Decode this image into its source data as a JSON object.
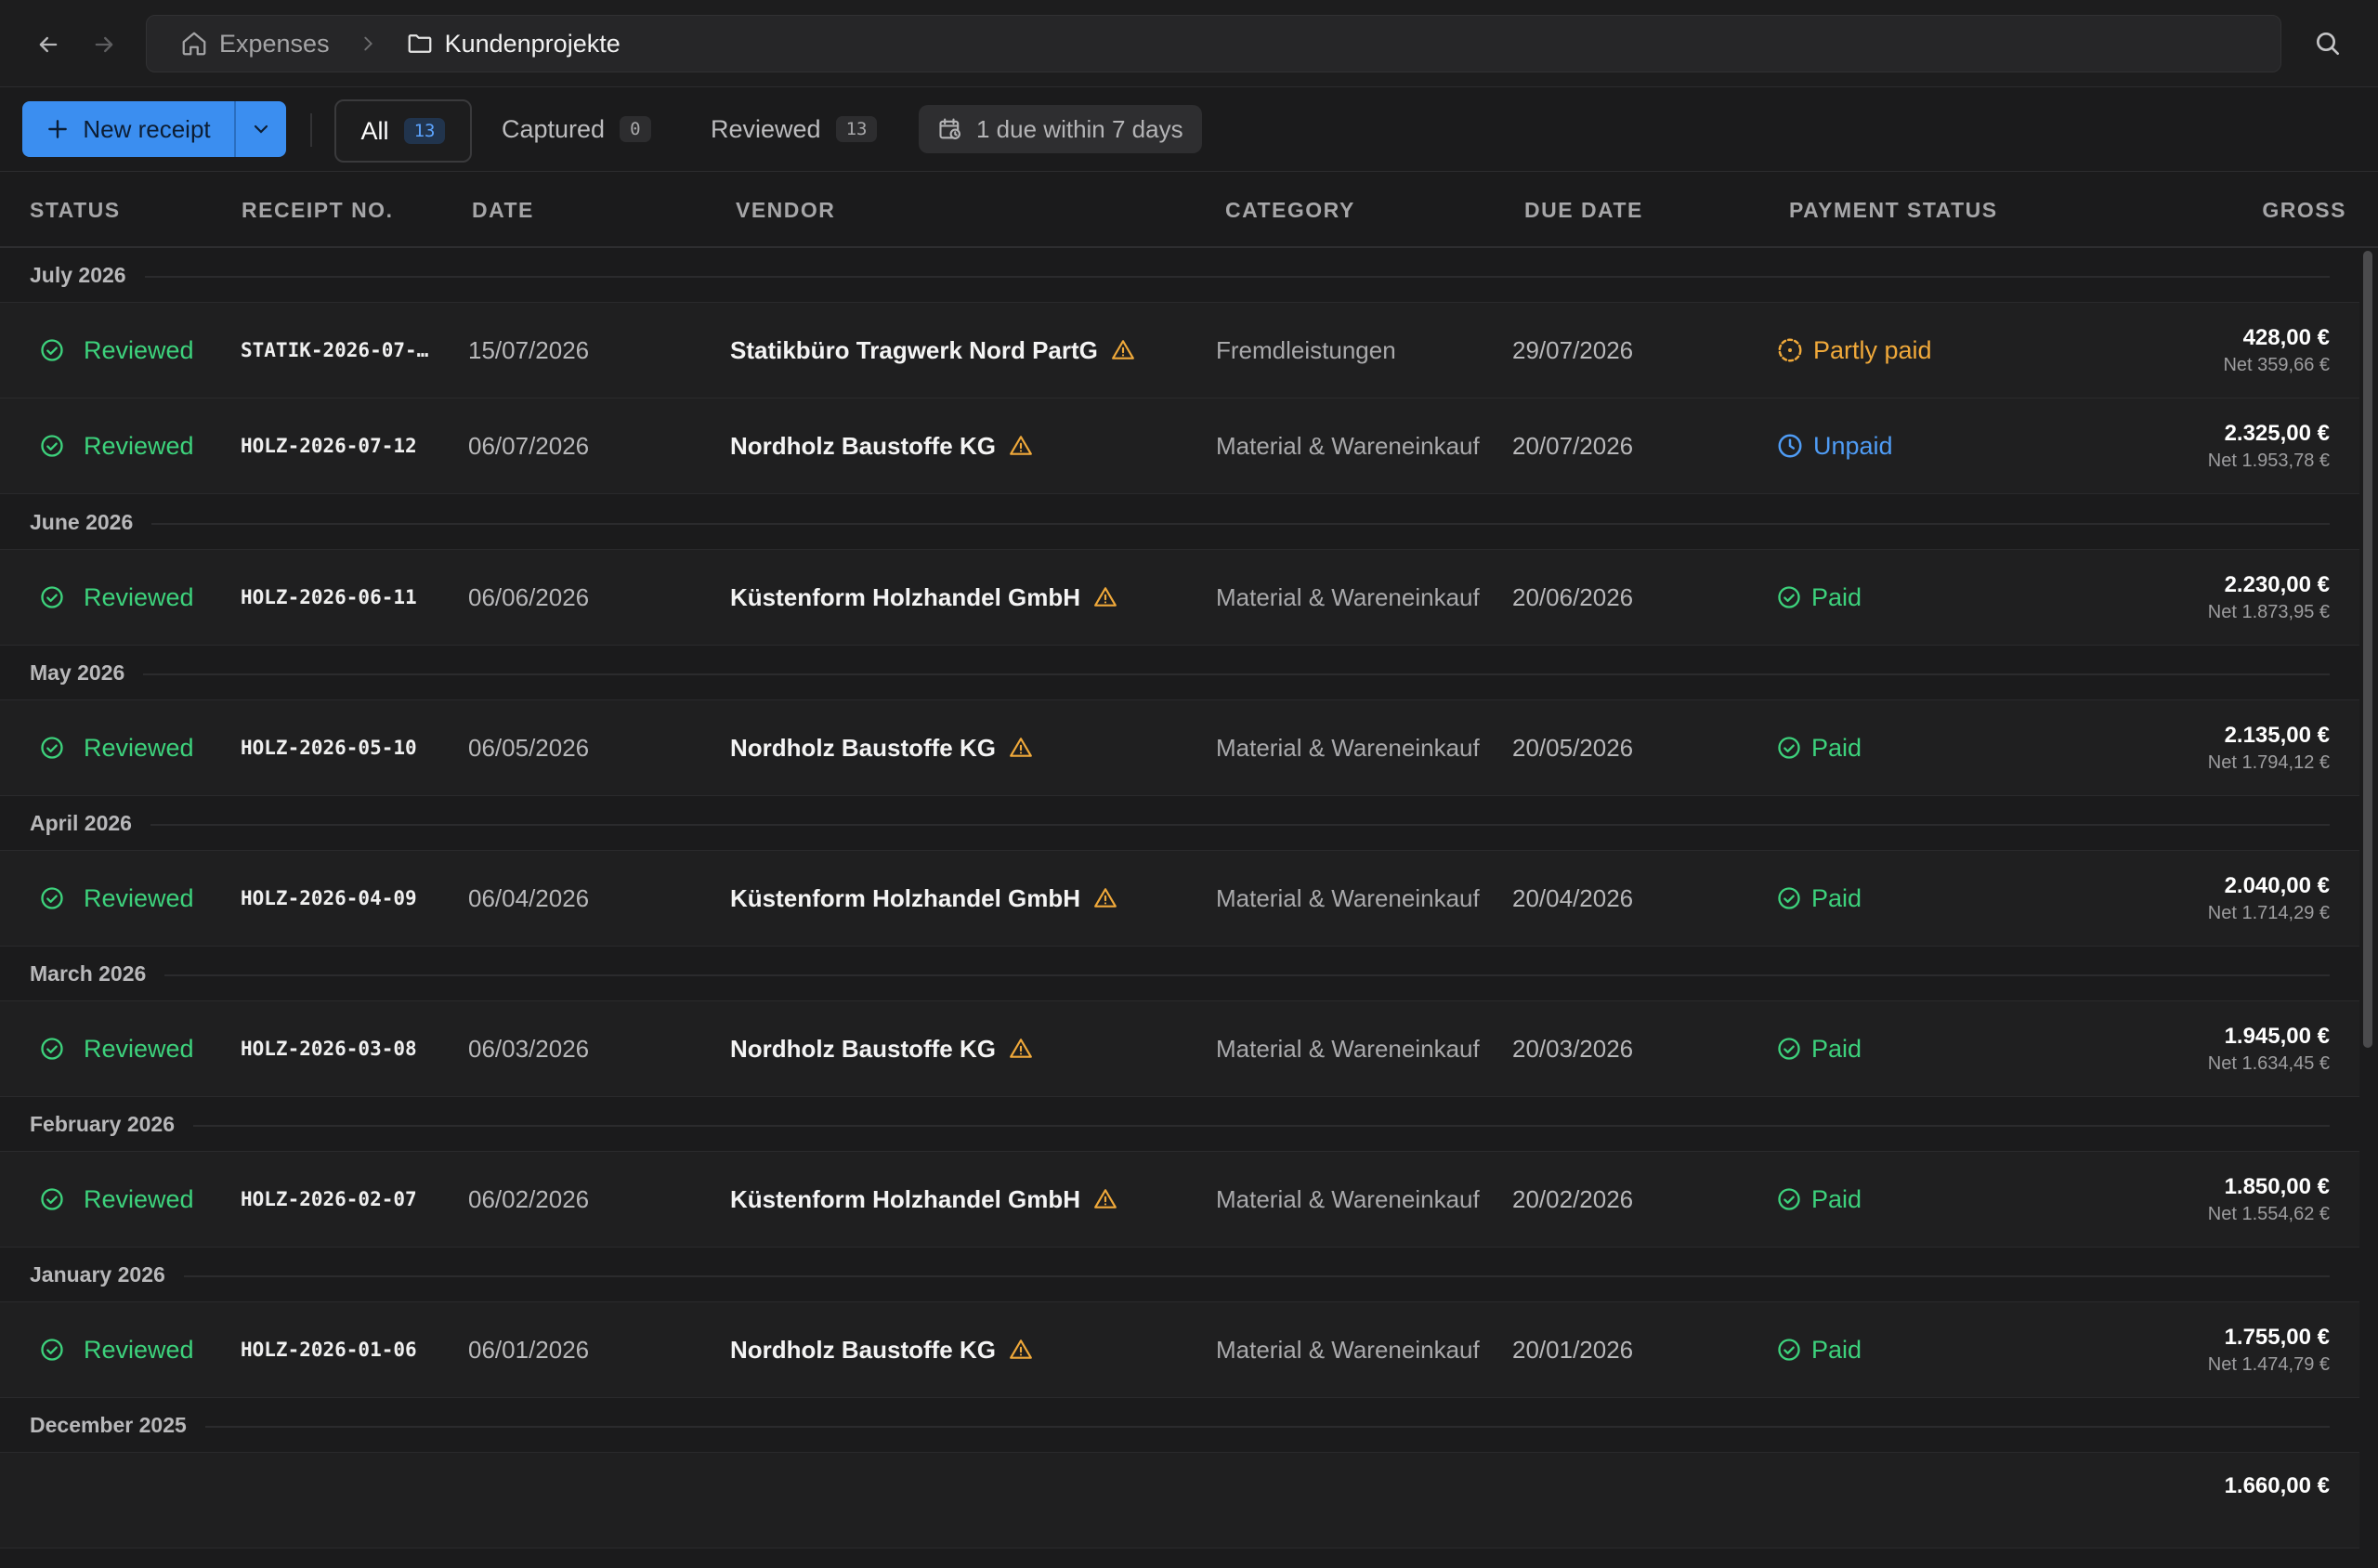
{
  "breadcrumb": {
    "home": "Expenses",
    "current": "Kundenprojekte"
  },
  "toolbar": {
    "new_receipt": "New receipt",
    "tabs": [
      {
        "label": "All",
        "count": "13"
      },
      {
        "label": "Captured",
        "count": "0"
      },
      {
        "label": "Reviewed",
        "count": "13"
      }
    ],
    "due_chip": "1 due within 7 days"
  },
  "columns": [
    "STATUS",
    "RECEIPT NO.",
    "DATE",
    "VENDOR",
    "CATEGORY",
    "DUE DATE",
    "PAYMENT STATUS",
    "GROSS"
  ],
  "colors": {
    "accent": "#3b8ef0",
    "reviewed": "#3dd27c",
    "paid": "#3dd27c",
    "partly_paid": "#f0a93a",
    "unpaid": "#4f9cf5",
    "warning": "#f0a93a"
  },
  "groups": [
    {
      "label": "July 2026",
      "rows": [
        {
          "status": "Reviewed",
          "receipt_no": "STATIK-2026-07-…",
          "date": "15/07/2026",
          "vendor": "Statikbüro Tragwerk Nord PartG",
          "category": "Fremdleistungen",
          "due_date": "29/07/2026",
          "payment": "Partly paid",
          "payment_kind": "partly",
          "gross": "428,00 €",
          "net": "Net 359,66 €"
        },
        {
          "status": "Reviewed",
          "receipt_no": "HOLZ-2026-07-12",
          "date": "06/07/2026",
          "vendor": "Nordholz Baustoffe KG",
          "category": "Material & Wareneinkauf",
          "due_date": "20/07/2026",
          "payment": "Unpaid",
          "payment_kind": "unpaid",
          "gross": "2.325,00 €",
          "net": "Net 1.953,78 €"
        }
      ]
    },
    {
      "label": "June 2026",
      "rows": [
        {
          "status": "Reviewed",
          "receipt_no": "HOLZ-2026-06-11",
          "date": "06/06/2026",
          "vendor": "Küstenform Holzhandel GmbH",
          "category": "Material & Wareneinkauf",
          "due_date": "20/06/2026",
          "payment": "Paid",
          "payment_kind": "paid",
          "gross": "2.230,00 €",
          "net": "Net 1.873,95 €"
        }
      ]
    },
    {
      "label": "May 2026",
      "rows": [
        {
          "status": "Reviewed",
          "receipt_no": "HOLZ-2026-05-10",
          "date": "06/05/2026",
          "vendor": "Nordholz Baustoffe KG",
          "category": "Material & Wareneinkauf",
          "due_date": "20/05/2026",
          "payment": "Paid",
          "payment_kind": "paid",
          "gross": "2.135,00 €",
          "net": "Net 1.794,12 €"
        }
      ]
    },
    {
      "label": "April 2026",
      "rows": [
        {
          "status": "Reviewed",
          "receipt_no": "HOLZ-2026-04-09",
          "date": "06/04/2026",
          "vendor": "Küstenform Holzhandel GmbH",
          "category": "Material & Wareneinkauf",
          "due_date": "20/04/2026",
          "payment": "Paid",
          "payment_kind": "paid",
          "gross": "2.040,00 €",
          "net": "Net 1.714,29 €"
        }
      ]
    },
    {
      "label": "March 2026",
      "rows": [
        {
          "status": "Reviewed",
          "receipt_no": "HOLZ-2026-03-08",
          "date": "06/03/2026",
          "vendor": "Nordholz Baustoffe KG",
          "category": "Material & Wareneinkauf",
          "due_date": "20/03/2026",
          "payment": "Paid",
          "payment_kind": "paid",
          "gross": "1.945,00 €",
          "net": "Net 1.634,45 €"
        }
      ]
    },
    {
      "label": "February 2026",
      "rows": [
        {
          "status": "Reviewed",
          "receipt_no": "HOLZ-2026-02-07",
          "date": "06/02/2026",
          "vendor": "Küstenform Holzhandel GmbH",
          "category": "Material & Wareneinkauf",
          "due_date": "20/02/2026",
          "payment": "Paid",
          "payment_kind": "paid",
          "gross": "1.850,00 €",
          "net": "Net 1.554,62 €"
        }
      ]
    },
    {
      "label": "January 2026",
      "rows": [
        {
          "status": "Reviewed",
          "receipt_no": "HOLZ-2026-01-06",
          "date": "06/01/2026",
          "vendor": "Nordholz Baustoffe KG",
          "category": "Material & Wareneinkauf",
          "due_date": "20/01/2026",
          "payment": "Paid",
          "payment_kind": "paid",
          "gross": "1.755,00 €",
          "net": "Net 1.474,79 €"
        }
      ]
    },
    {
      "label": "December 2025",
      "rows": [
        {
          "gross": "1.660,00 €"
        }
      ]
    }
  ]
}
